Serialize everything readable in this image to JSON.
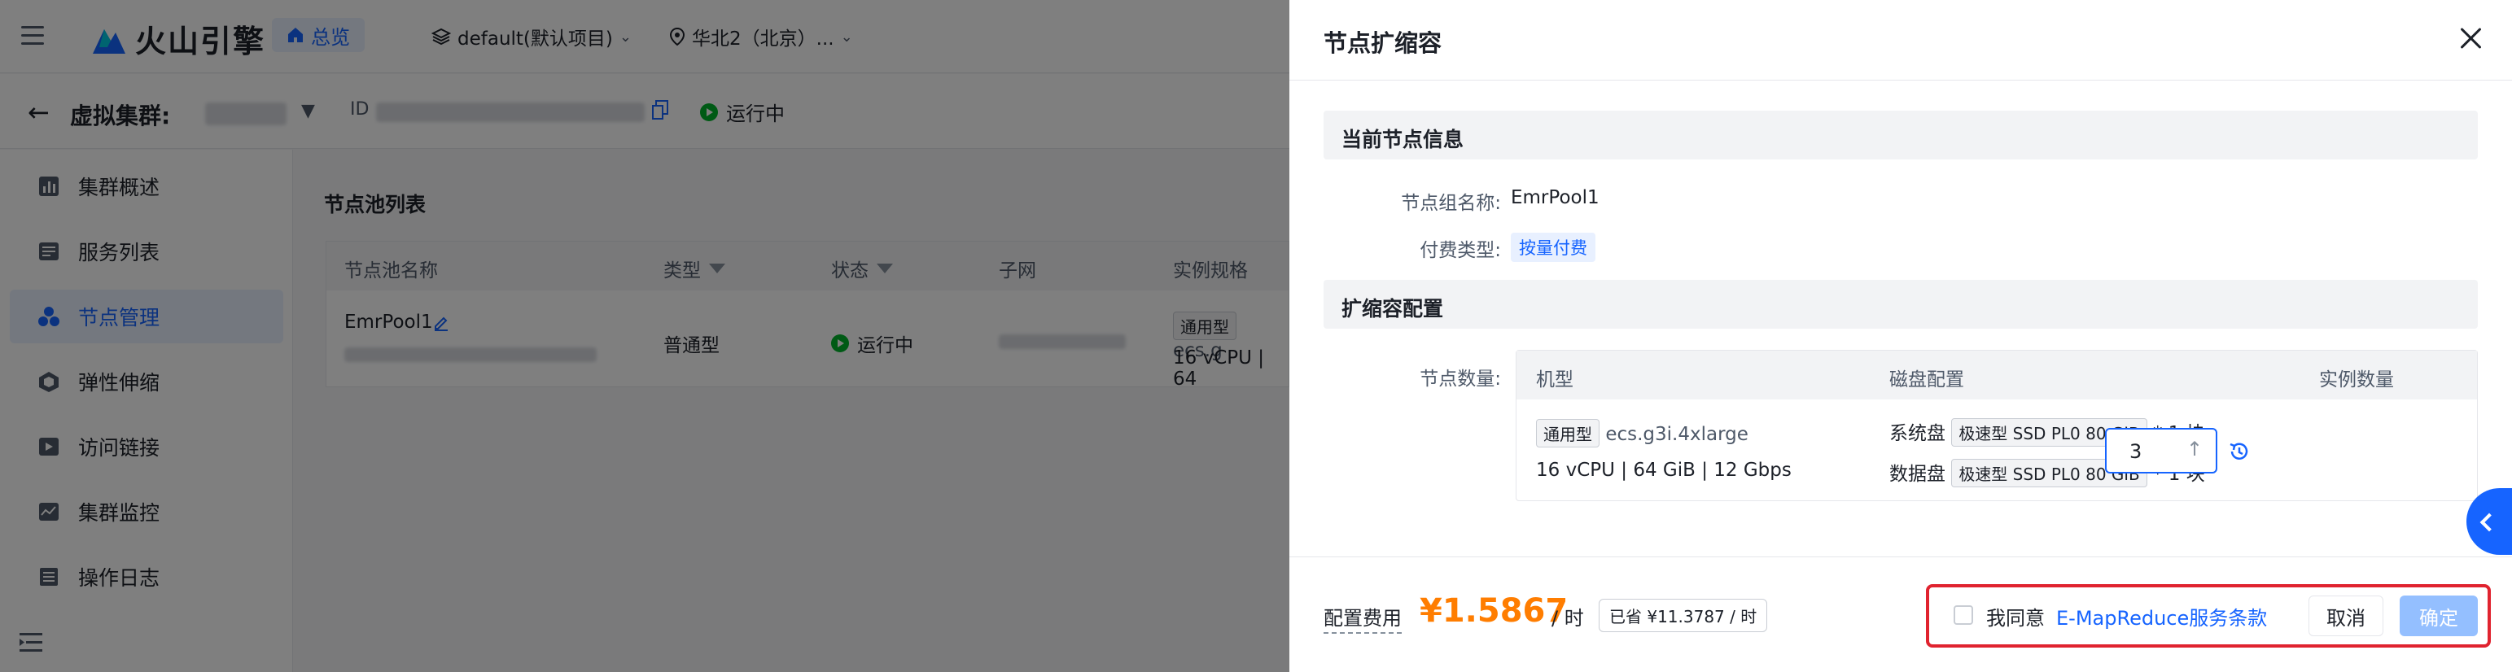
{
  "topbar": {
    "brand": "火山引擎",
    "home_label": "总览",
    "project": "default(默认项目)",
    "region": "华北2（北京）..."
  },
  "subbar": {
    "title": "虚拟集群:",
    "id_label": "ID",
    "status": "运行中"
  },
  "sidebar": {
    "items": [
      {
        "label": "集群概述",
        "icon": "chart-icon"
      },
      {
        "label": "服务列表",
        "icon": "list-icon"
      },
      {
        "label": "节点管理",
        "icon": "nodes-icon",
        "active": true
      },
      {
        "label": "弹性伸缩",
        "icon": "scale-icon"
      },
      {
        "label": "访问链接",
        "icon": "link-icon"
      },
      {
        "label": "集群监控",
        "icon": "monitor-icon"
      },
      {
        "label": "操作日志",
        "icon": "log-icon"
      }
    ]
  },
  "main": {
    "title": "节点池列表",
    "columns": [
      "节点池名称",
      "类型",
      "状态",
      "子网",
      "实例规格"
    ],
    "row": {
      "name": "EmrPool1",
      "type": "普通型",
      "status": "运行中",
      "spec_tag": "通用型",
      "spec_model": "ecs.g",
      "spec_detail": "16 vCPU | 64"
    }
  },
  "drawer": {
    "title": "节点扩缩容",
    "current_section": "当前节点信息",
    "group_name_label": "节点组名称:",
    "group_name": "EmrPool1",
    "pay_type_label": "付费类型:",
    "pay_type": "按量付费",
    "scale_section": "扩缩容配置",
    "node_count_label": "节点数量:",
    "table_headers": [
      "机型",
      "磁盘配置",
      "实例数量"
    ],
    "machine_tag": "通用型",
    "machine_model": "ecs.g3i.4xlarge",
    "machine_spec": "16 vCPU | 64 GiB | 12 Gbps",
    "sys_disk_label": "系统盘",
    "sys_disk_tag": "极速型 SSD PL0 80 GiB",
    "sys_disk_count": "* 1 块",
    "data_disk_label": "数据盘",
    "data_disk_tag": "极速型 SSD PL0 80 GiB",
    "data_disk_count": "* 1 块",
    "instance_count": "3",
    "cost_label": "配置费用",
    "cost_value": "¥1.5867",
    "cost_unit": "/ 时",
    "saved": "已省 ¥11.3787 / 时",
    "agree_label": "我同意",
    "terms_link": "E-MapReduce服务条款",
    "cancel_label": "取消",
    "ok_label": "确定"
  },
  "colors": {
    "primary": "#1664ff",
    "price": "#ff7d00",
    "highlight_box": "#e0232f",
    "success": "#00b42a"
  }
}
